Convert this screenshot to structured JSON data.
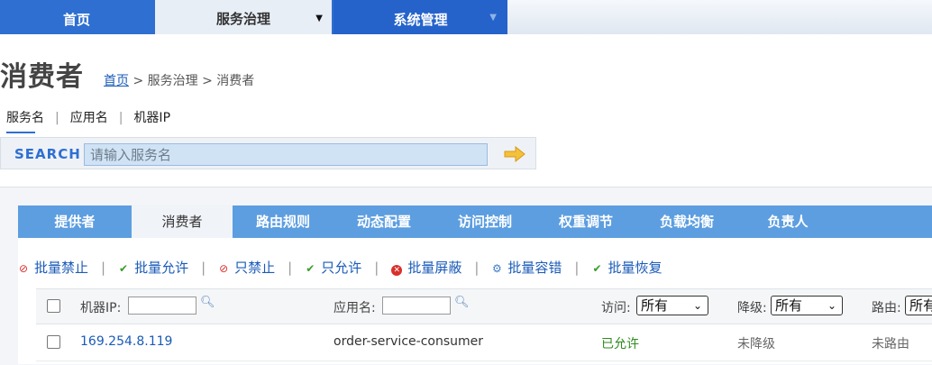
{
  "nav": {
    "home": "首页",
    "governance": "服务治理",
    "system": "系统管理",
    "caret": "▼"
  },
  "header": {
    "title": "消费者",
    "breadcrumb": {
      "home": "首页",
      "rest": " > 服务治理 > 消费者"
    }
  },
  "search": {
    "tabs": [
      "服务名",
      "应用名",
      "机器IP"
    ],
    "label": "SEARCH",
    "placeholder": "请输入服务名",
    "value": ""
  },
  "tabs": [
    "提供者",
    "消费者",
    "路由规则",
    "动态配置",
    "访问控制",
    "权重调节",
    "负载均衡",
    "负责人"
  ],
  "toolbar": {
    "batch_forbid": "批量禁止",
    "batch_allow": "批量允许",
    "only_forbid": "只禁止",
    "only_allow": "只允许",
    "batch_shield": "批量屏蔽",
    "batch_tolerant": "批量容错",
    "batch_recover": "批量恢复"
  },
  "table": {
    "headers": {
      "ip": "机器IP:",
      "app": "应用名:",
      "access": "访问:",
      "degrade": "降级:",
      "route": "路由:"
    },
    "filters": {
      "access": "所有",
      "degrade": "所有",
      "route": "所有"
    },
    "rows": [
      {
        "ip": "169.254.8.119",
        "app": "order-service-consumer",
        "access": "已允许",
        "degrade": "未降级",
        "route": "未路由"
      }
    ]
  },
  "colors": {
    "nav_blue": "#2f6fd1",
    "tab_blue": "#5d9ee0",
    "link_blue": "#1a5bb8",
    "allowed_green": "#2f8a1f"
  }
}
